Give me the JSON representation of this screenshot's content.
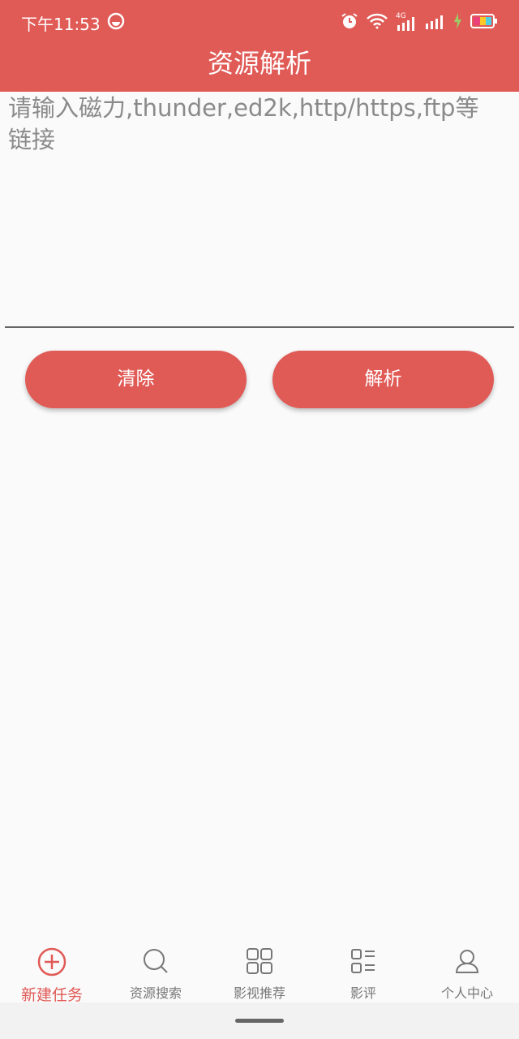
{
  "status_bar": {
    "time": "下午11:53",
    "network_label": "4G",
    "icons": [
      "app-notification-icon",
      "alarm-icon",
      "wifi-icon",
      "signal-4g-icon",
      "signal-icon",
      "charging-icon",
      "battery-icon"
    ]
  },
  "header": {
    "title": "资源解析"
  },
  "input": {
    "placeholder": "请输入磁力,thunder,ed2k,http/https,ftp等链接",
    "value": ""
  },
  "buttons": {
    "clear": "清除",
    "parse": "解析"
  },
  "tabs": [
    {
      "label": "新建任务",
      "icon": "plus-circle-icon",
      "active": true
    },
    {
      "label": "资源搜索",
      "icon": "search-icon",
      "active": false
    },
    {
      "label": "影视推荐",
      "icon": "grid-icon",
      "active": false
    },
    {
      "label": "影评",
      "icon": "list-icon",
      "active": false
    },
    {
      "label": "个人中心",
      "icon": "user-icon",
      "active": false
    }
  ],
  "colors": {
    "primary": "#e05a56",
    "background": "#fafafa",
    "placeholder": "#8a8a8a"
  }
}
